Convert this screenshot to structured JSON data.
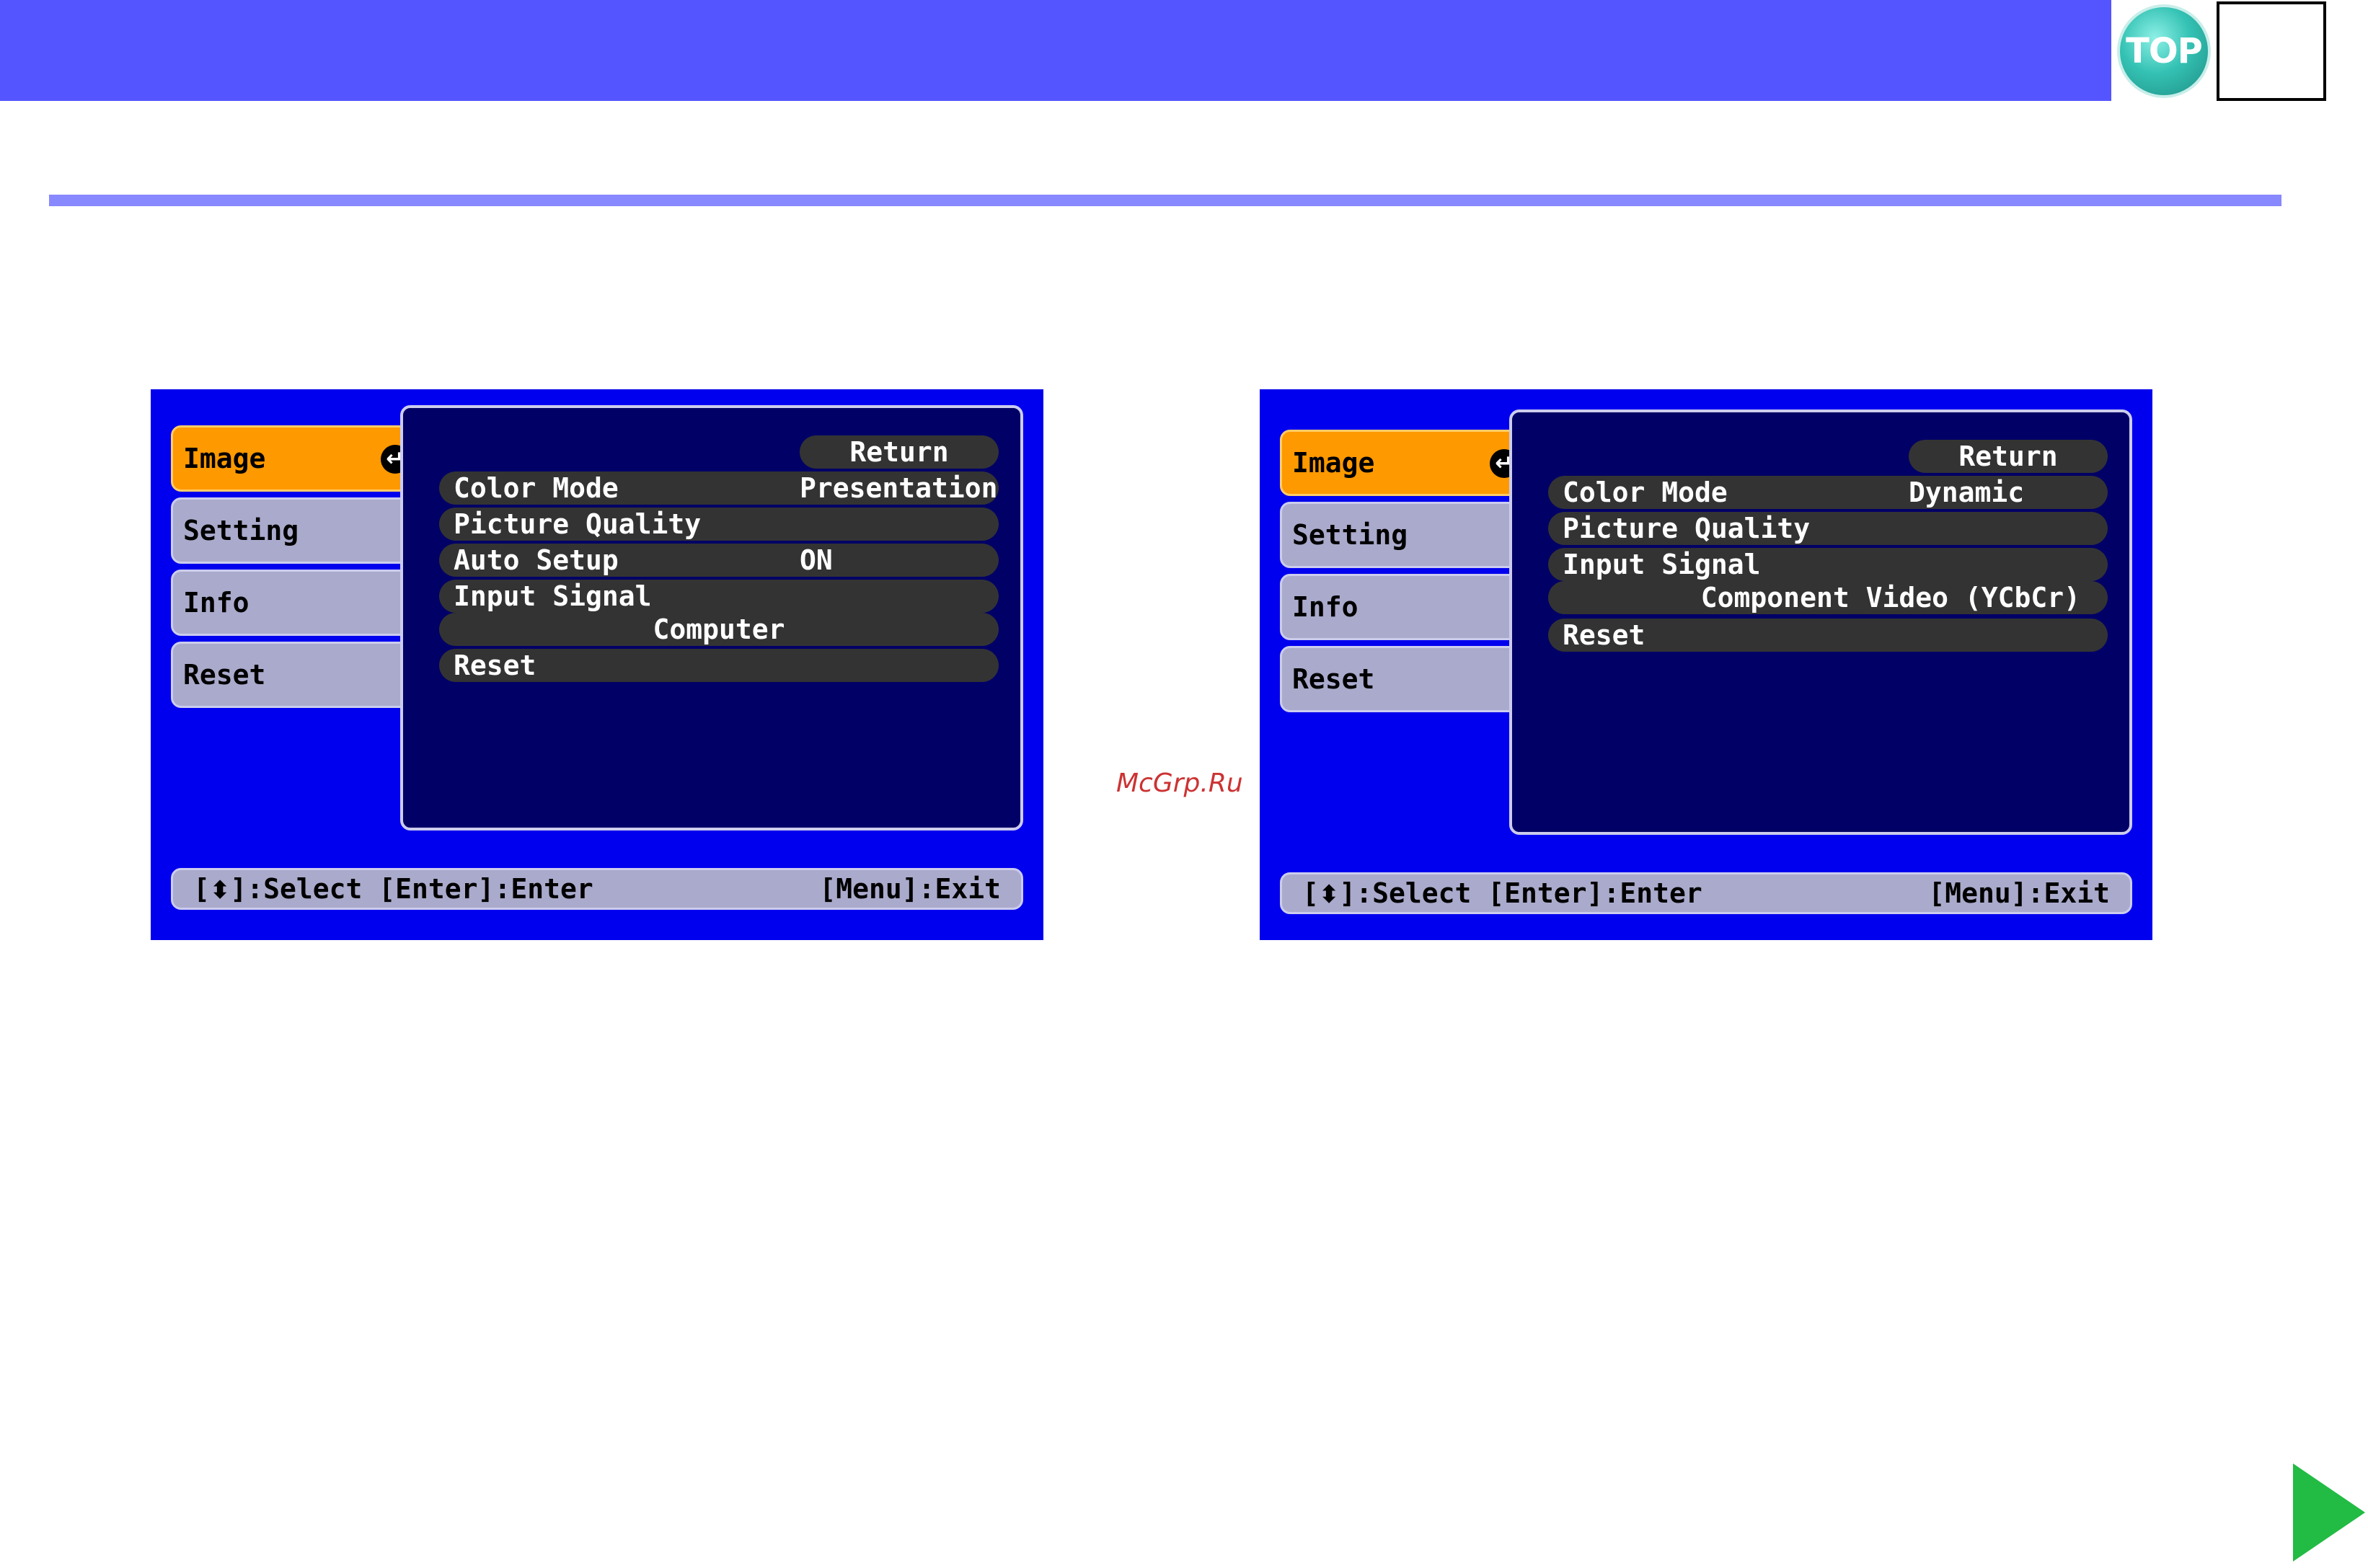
{
  "header": {
    "top_button_label": "TOP"
  },
  "watermark": "McGrp.Ru",
  "screens": [
    {
      "tabs": [
        "Image",
        "Setting",
        "Info",
        "Reset"
      ],
      "return_label": "Return",
      "rows": [
        {
          "label": "Color Mode",
          "value": "Presentation"
        },
        {
          "label": "Picture Quality",
          "value": ""
        },
        {
          "label": "Auto Setup",
          "value": "ON"
        },
        {
          "label": "Input Signal",
          "value": ""
        },
        {
          "label": "",
          "value": "Computer"
        },
        {
          "label": "Reset",
          "value": ""
        }
      ],
      "status_left": "]:Select [Enter]:Enter",
      "status_bracket": "[",
      "status_right": "[Menu]:Exit"
    },
    {
      "tabs": [
        "Image",
        "Setting",
        "Info",
        "Reset"
      ],
      "return_label": "Return",
      "rows": [
        {
          "label": "Color Mode",
          "value": "Dynamic"
        },
        {
          "label": "Picture Quality",
          "value": ""
        },
        {
          "label": "Input Signal",
          "value": ""
        },
        {
          "label": "",
          "value": "Component Video (YCbCr)"
        },
        {
          "label": "Reset",
          "value": ""
        }
      ],
      "status_left": "]:Select [Enter]:Enter",
      "status_bracket": "[",
      "status_right": "[Menu]:Exit"
    }
  ],
  "icons": {
    "top": "top-icon",
    "next": "next-page-arrow-icon",
    "enter": "enter-return-icon",
    "updown": "up-down-arrow-icon"
  },
  "colors": {
    "banner": "#5555ff",
    "screen": "#0000ee",
    "active_tab": "#ff9900",
    "panel": "#000066"
  }
}
